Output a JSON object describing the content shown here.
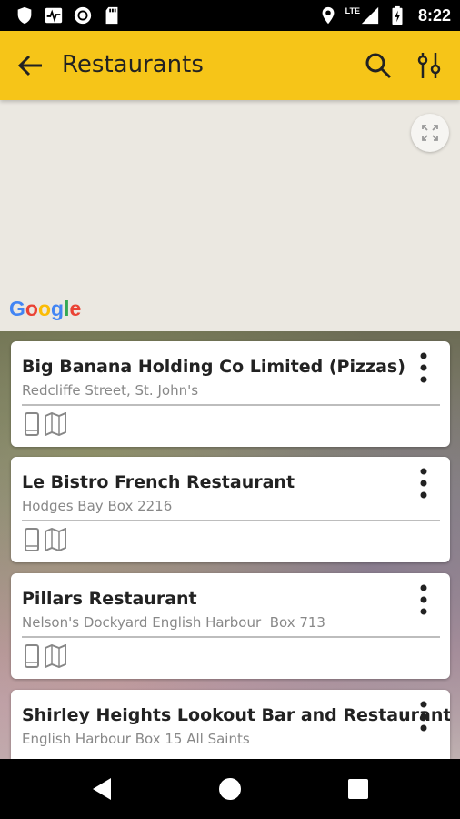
{
  "status_bar": {
    "time": "8:22",
    "network": "LTE",
    "left_icons": [
      "shield-icon",
      "activity-icon",
      "circle-record-icon",
      "sd-card-icon"
    ],
    "right_icons": [
      "location-icon",
      "signal-icon",
      "battery-icon"
    ]
  },
  "app_bar": {
    "title": "Restaurants",
    "background": "#f6c518",
    "actions": [
      "back-arrow-icon",
      "search-icon",
      "filter-sliders-icon"
    ]
  },
  "map": {
    "attribution": [
      "G",
      "o",
      "o",
      "g",
      "l",
      "e"
    ],
    "attribution_colors": [
      "#4285F4",
      "#EA4335",
      "#FBBC05",
      "#4285F4",
      "#34A853",
      "#EA4335"
    ]
  },
  "restaurants": [
    {
      "name": "Big Banana Holding Co Limited (Pizzas)",
      "address": "Redcliffe Street, St. John's"
    },
    {
      "name": "Le Bistro French Restaurant",
      "address": "Hodges Bay Box 2216"
    },
    {
      "name": "Pillars Restaurant",
      "address": "Nelson's Dockyard English Harbour  Box 713"
    },
    {
      "name": "Shirley Heights Lookout Bar and Restaurant",
      "address": "English Harbour Box 15 All Saints"
    }
  ],
  "nav_bar": {
    "buttons": [
      "back-triangle-icon",
      "home-circle-icon",
      "recents-square-icon"
    ]
  }
}
